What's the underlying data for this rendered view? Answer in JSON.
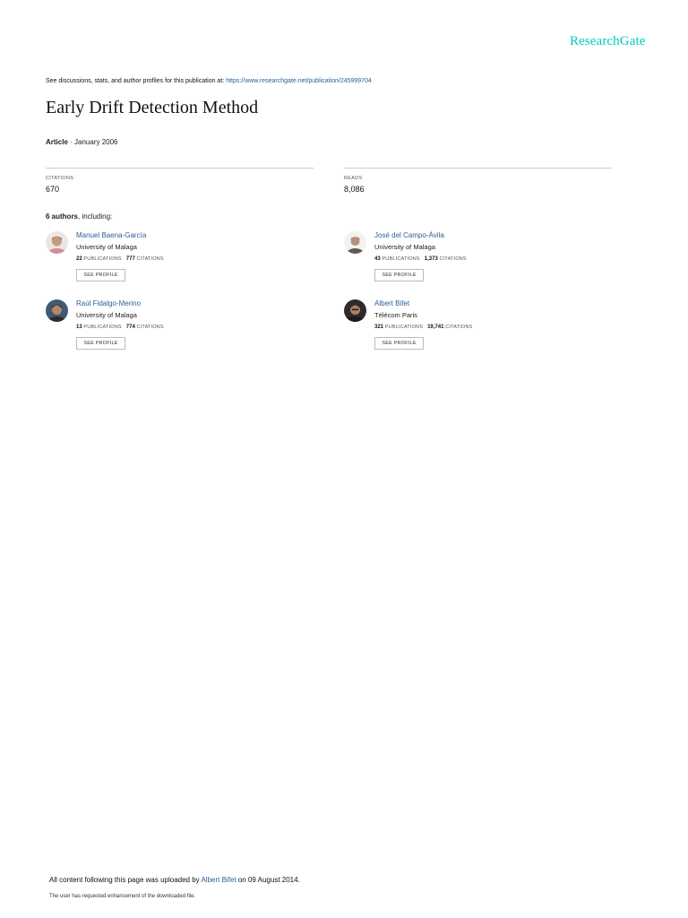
{
  "brand": "ResearchGate",
  "discussion": {
    "text": "See discussions, stats, and author profiles for this publication at:",
    "url": "https://www.researchgate.net/publication/245999704"
  },
  "title": "Early Drift Detection Method",
  "meta": {
    "type": "Article",
    "date": "· January 2006"
  },
  "stats": {
    "citations_label": "CITATIONS",
    "citations_value": "670",
    "reads_label": "READS",
    "reads_value": "8,086"
  },
  "authors_heading": {
    "count": "6 authors",
    "suffix": ", including:"
  },
  "publications_label": "PUBLICATIONS",
  "citations_label": "CITATIONS",
  "see_profile_label": "SEE PROFILE",
  "authors": [
    {
      "name": "Manuel Baena-García",
      "institution": "University of Malaga",
      "publications": "22",
      "citations": "777"
    },
    {
      "name": "José del Campo-Ávila",
      "institution": "University of Malaga",
      "publications": "43",
      "citations": "1,373"
    },
    {
      "name": "Raúl Fidalgo-Merino",
      "institution": "University of Malaga",
      "publications": "13",
      "citations": "774"
    },
    {
      "name": "Albert Bifet",
      "institution": "Télécom Paris",
      "publications": "321",
      "citations": "19,741"
    }
  ],
  "footer": {
    "uploaded_prefix": "All content following this page was uploaded by",
    "uploader": "Albert Bifet",
    "uploaded_suffix": "on 09 August 2014.",
    "note": "The user has requested enhancement of the downloaded file."
  }
}
